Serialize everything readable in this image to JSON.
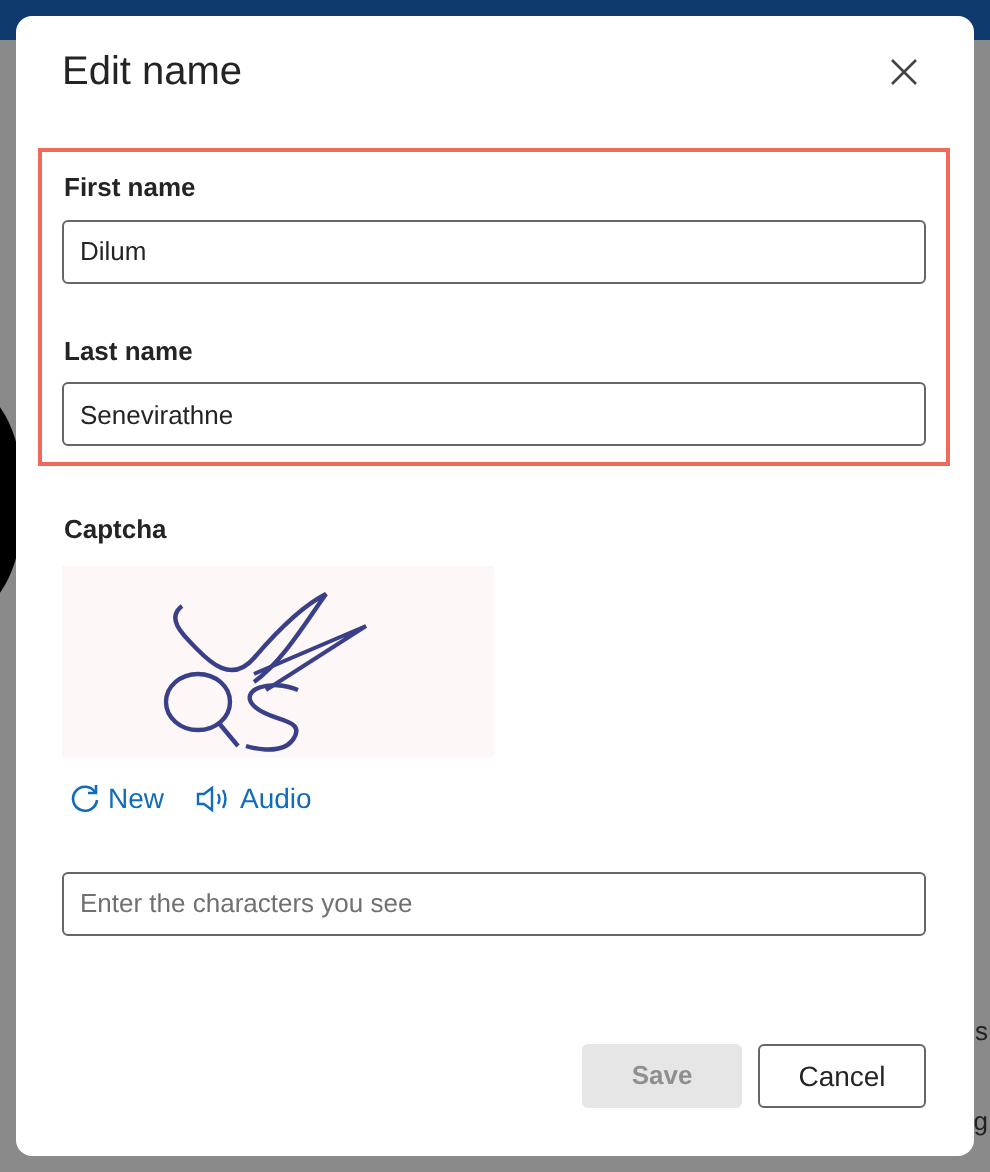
{
  "background": {
    "fragments": [
      "s",
      "g"
    ]
  },
  "dialog": {
    "title": "Edit name",
    "name_section": {
      "highlighted": true
    },
    "fields": [
      {
        "label": "First name",
        "value": "Dilum"
      },
      {
        "label": "Last name",
        "value": "Senevirathne"
      }
    ],
    "captcha": {
      "label": "Captcha",
      "actions": [
        {
          "kind": "refresh",
          "label": "New"
        },
        {
          "kind": "audio",
          "label": "Audio"
        }
      ],
      "input": {
        "placeholder": "Enter the characters you see"
      }
    },
    "buttons": [
      {
        "label": "Save",
        "disabled": true
      },
      {
        "label": "Cancel",
        "disabled": false
      }
    ]
  }
}
